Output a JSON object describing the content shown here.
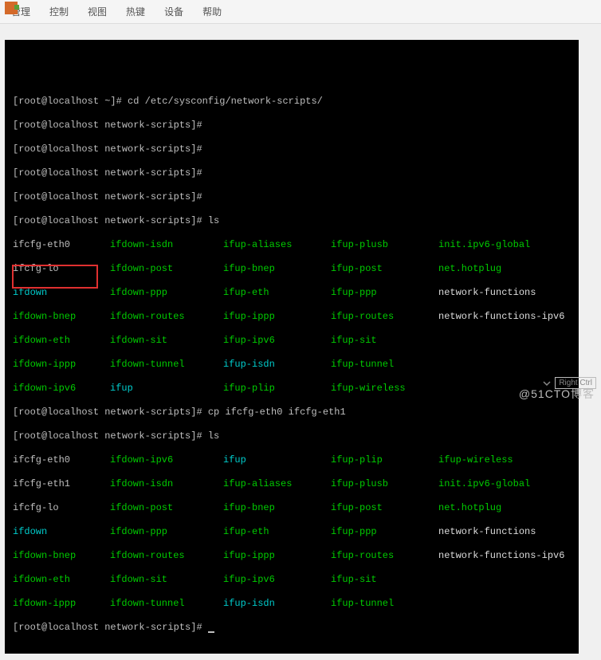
{
  "menu": {
    "items": [
      "管理",
      "控制",
      "视图",
      "热键",
      "设备",
      "帮助"
    ]
  },
  "prompt_home": "[root@localhost ~]#",
  "prompt_ns": "[root@localhost network-scripts]#",
  "cmds": {
    "cd": "cd /etc/sysconfig/network-scripts/",
    "ls": "ls",
    "cp": "cp ifcfg-eth0 ifcfg-eth1"
  },
  "ls1": {
    "r1": {
      "c1": "ifcfg-eth0",
      "c2": "ifdown-isdn",
      "c3": "ifup-aliases",
      "c4": "ifup-plusb",
      "c5": "init.ipv6-global"
    },
    "r2": {
      "c1": "ifcfg-lo",
      "c2": "ifdown-post",
      "c3": "ifup-bnep",
      "c4": "ifup-post",
      "c5": "net.hotplug"
    },
    "r3": {
      "c1": "ifdown",
      "c2": "ifdown-ppp",
      "c3": "ifup-eth",
      "c4": "ifup-ppp",
      "c5": "network-functions"
    },
    "r4": {
      "c1": "ifdown-bnep",
      "c2": "ifdown-routes",
      "c3": "ifup-ippp",
      "c4": "ifup-routes",
      "c5": "network-functions-ipv6"
    },
    "r5": {
      "c1": "ifdown-eth",
      "c2": "ifdown-sit",
      "c3": "ifup-ipv6",
      "c4": "ifup-sit"
    },
    "r6": {
      "c1": "ifdown-ippp",
      "c2": "ifdown-tunnel",
      "c3": "ifup-isdn",
      "c4": "ifup-tunnel"
    },
    "r7": {
      "c1": "ifdown-ipv6",
      "c2": "ifup",
      "c3": "ifup-plip",
      "c4": "ifup-wireless"
    }
  },
  "ls2": {
    "r1": {
      "c1": "ifcfg-eth0",
      "c2": "ifdown-ipv6",
      "c3": "ifup",
      "c4": "ifup-plip",
      "c5": "ifup-wireless"
    },
    "r2": {
      "c1": "ifcfg-eth1",
      "c2": "ifdown-isdn",
      "c3": "ifup-aliases",
      "c4": "ifup-plusb",
      "c5": "init.ipv6-global"
    },
    "r3": {
      "c1": "ifcfg-lo",
      "c2": "ifdown-post",
      "c3": "ifup-bnep",
      "c4": "ifup-post",
      "c5": "net.hotplug"
    },
    "r4": {
      "c1": "ifdown",
      "c2": "ifdown-ppp",
      "c3": "ifup-eth",
      "c4": "ifup-ppp",
      "c5": "network-functions"
    },
    "r5": {
      "c1": "ifdown-bnep",
      "c2": "ifdown-routes",
      "c3": "ifup-ippp",
      "c4": "ifup-routes",
      "c5": "network-functions-ipv6"
    },
    "r6": {
      "c1": "ifdown-eth",
      "c2": "ifdown-sit",
      "c3": "ifup-ipv6",
      "c4": "ifup-sit"
    },
    "r7": {
      "c1": "ifdown-ippp",
      "c2": "ifdown-tunnel",
      "c3": "ifup-isdn",
      "c4": "ifup-tunnel"
    }
  },
  "status": {
    "rightctrl": "Right Ctrl"
  },
  "watermark": "@51CTO博客"
}
